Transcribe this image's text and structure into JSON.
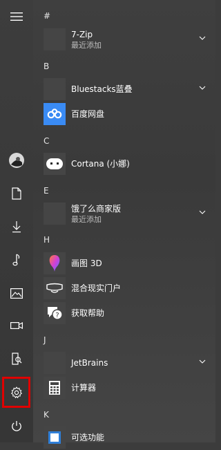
{
  "rail": {
    "items": [
      "hamburger-icon",
      "avatar",
      "document-icon",
      "downloads-icon",
      "music-icon",
      "pictures-icon",
      "videos-icon",
      "file-explorer-icon",
      "settings-icon",
      "power-icon"
    ]
  },
  "list": {
    "sections": [
      {
        "header": "#"
      },
      {
        "header": "B"
      },
      {
        "header": "C"
      },
      {
        "header": "E"
      },
      {
        "header": "H"
      },
      {
        "header": "J"
      },
      {
        "header": "K"
      }
    ],
    "apps": {
      "sevenzip": {
        "name": "7-Zip",
        "sub": "最近添加"
      },
      "bluestacks": {
        "name": "Bluestacks蓝叠"
      },
      "baidu": {
        "name": "百度网盘"
      },
      "cortana": {
        "name": "Cortana (小娜)"
      },
      "eleme": {
        "name": "饿了么商家版",
        "sub": "最近添加"
      },
      "paint3d": {
        "name": "画图 3D"
      },
      "mixedreality": {
        "name": "混合现实门户"
      },
      "gethelp": {
        "name": "获取帮助"
      },
      "jetbrains": {
        "name": "JetBrains"
      },
      "calculator": {
        "name": "计算器"
      },
      "optional": {
        "name": "可选功能"
      }
    }
  },
  "colors": {
    "highlight": "#e00000",
    "accent": "#3a8bf4"
  }
}
